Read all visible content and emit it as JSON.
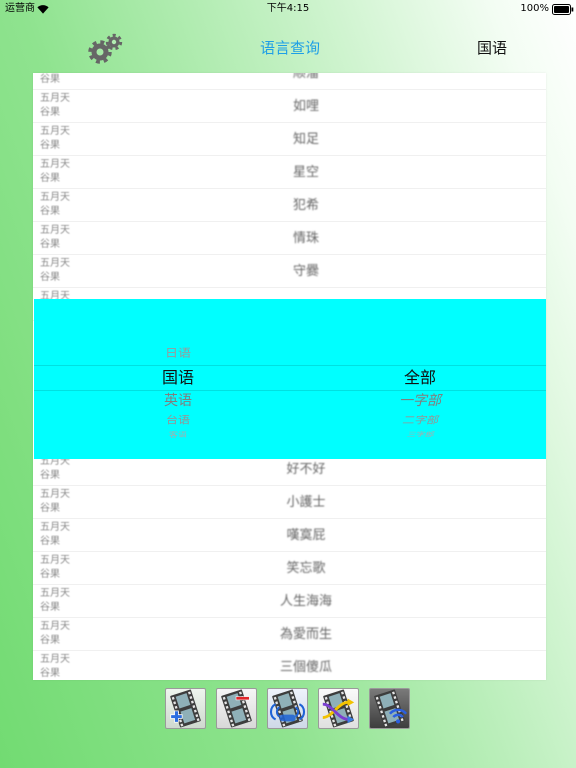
{
  "status_bar": {
    "carrier": "运营商",
    "time": "下午4:15",
    "battery": "100%",
    "wifi_icon": "wifi-icon",
    "battery_icon": "battery-icon"
  },
  "nav": {
    "left_icon": "gear-icon",
    "title": "语言查询",
    "right_label": "国语"
  },
  "list": {
    "rows_above": [
      {
        "line2": "谷果",
        "title": "顺溜"
      },
      {
        "line1": "五月天",
        "line2": "谷果",
        "title": "如哩"
      },
      {
        "line1": "五月天",
        "line2": "谷果",
        "title": "知足"
      },
      {
        "line1": "五月天",
        "line2": "谷果",
        "title": "星空"
      },
      {
        "line1": "五月天",
        "line2": "谷果",
        "title": "犯希"
      },
      {
        "line1": "五月天",
        "line2": "谷果",
        "title": "情珠"
      },
      {
        "line1": "五月天",
        "line2": "谷果",
        "title": "守爨"
      },
      {
        "line1": "五月天"
      }
    ],
    "rows_below": [
      {
        "line1": "五月天",
        "line2": "谷果",
        "title": "好不好"
      },
      {
        "line1": "五月天",
        "line2": "谷果",
        "title": "小護士"
      },
      {
        "line1": "五月天",
        "line2": "谷果",
        "title": "嘆寞屁"
      },
      {
        "line1": "五月天",
        "line2": "谷果",
        "title": "笑忘歌"
      },
      {
        "line1": "五月天",
        "line2": "谷果",
        "title": "人生海海"
      },
      {
        "line1": "五月天",
        "line2": "谷果",
        "title": "為愛而生"
      },
      {
        "line1": "五月天",
        "line2": "谷果",
        "title": "三個傻瓜"
      }
    ]
  },
  "picker": {
    "language_column": {
      "above": [
        "日语"
      ],
      "selected": "国语",
      "below": [
        "英语",
        "台语",
        "客语"
      ]
    },
    "category_column": {
      "selected": "全部",
      "below": [
        "一字部",
        "二字部",
        "三字部"
      ]
    }
  },
  "toolbar": {
    "buttons": [
      {
        "icon": "film-add-icon"
      },
      {
        "icon": "film-remove-icon"
      },
      {
        "icon": "film-broadcast-icon"
      },
      {
        "icon": "film-shuffle-icon"
      },
      {
        "icon": "film-wifi-icon"
      }
    ]
  },
  "colors": {
    "title": "#1e9fe6",
    "picker_background": "#00ffff",
    "list_background": "#ffffff",
    "background_green": "#72db72"
  }
}
